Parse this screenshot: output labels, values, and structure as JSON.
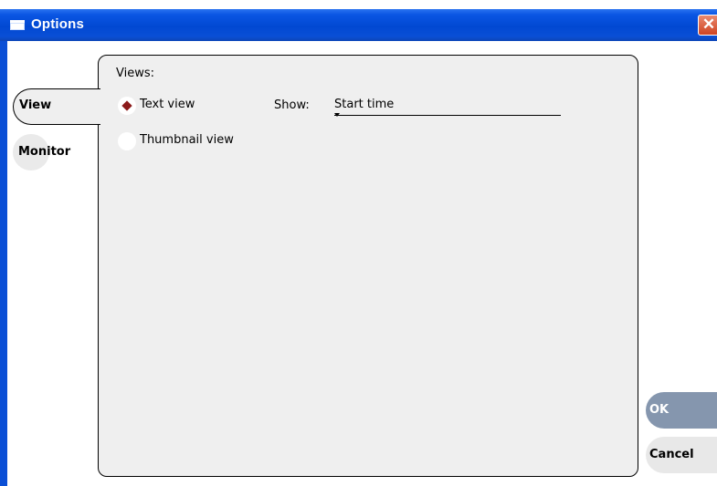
{
  "window": {
    "title": "Options",
    "close_glyph": "✕"
  },
  "tabs": [
    {
      "label": "View",
      "selected": true
    },
    {
      "label": "Monitor",
      "selected": false
    }
  ],
  "views": {
    "label": "Views:",
    "options": [
      {
        "label": "Text view",
        "selected": true
      },
      {
        "label": "Thumbnail view",
        "selected": false
      }
    ]
  },
  "show": {
    "label": "Show:",
    "value": "Start time"
  },
  "buttons": {
    "ok": "OK",
    "cancel": "Cancel"
  },
  "colors": {
    "titlebar": "#0148d2",
    "panel": "#efefef",
    "ok_button": "#8596ae",
    "radio_selected": "#8b1a1a"
  }
}
